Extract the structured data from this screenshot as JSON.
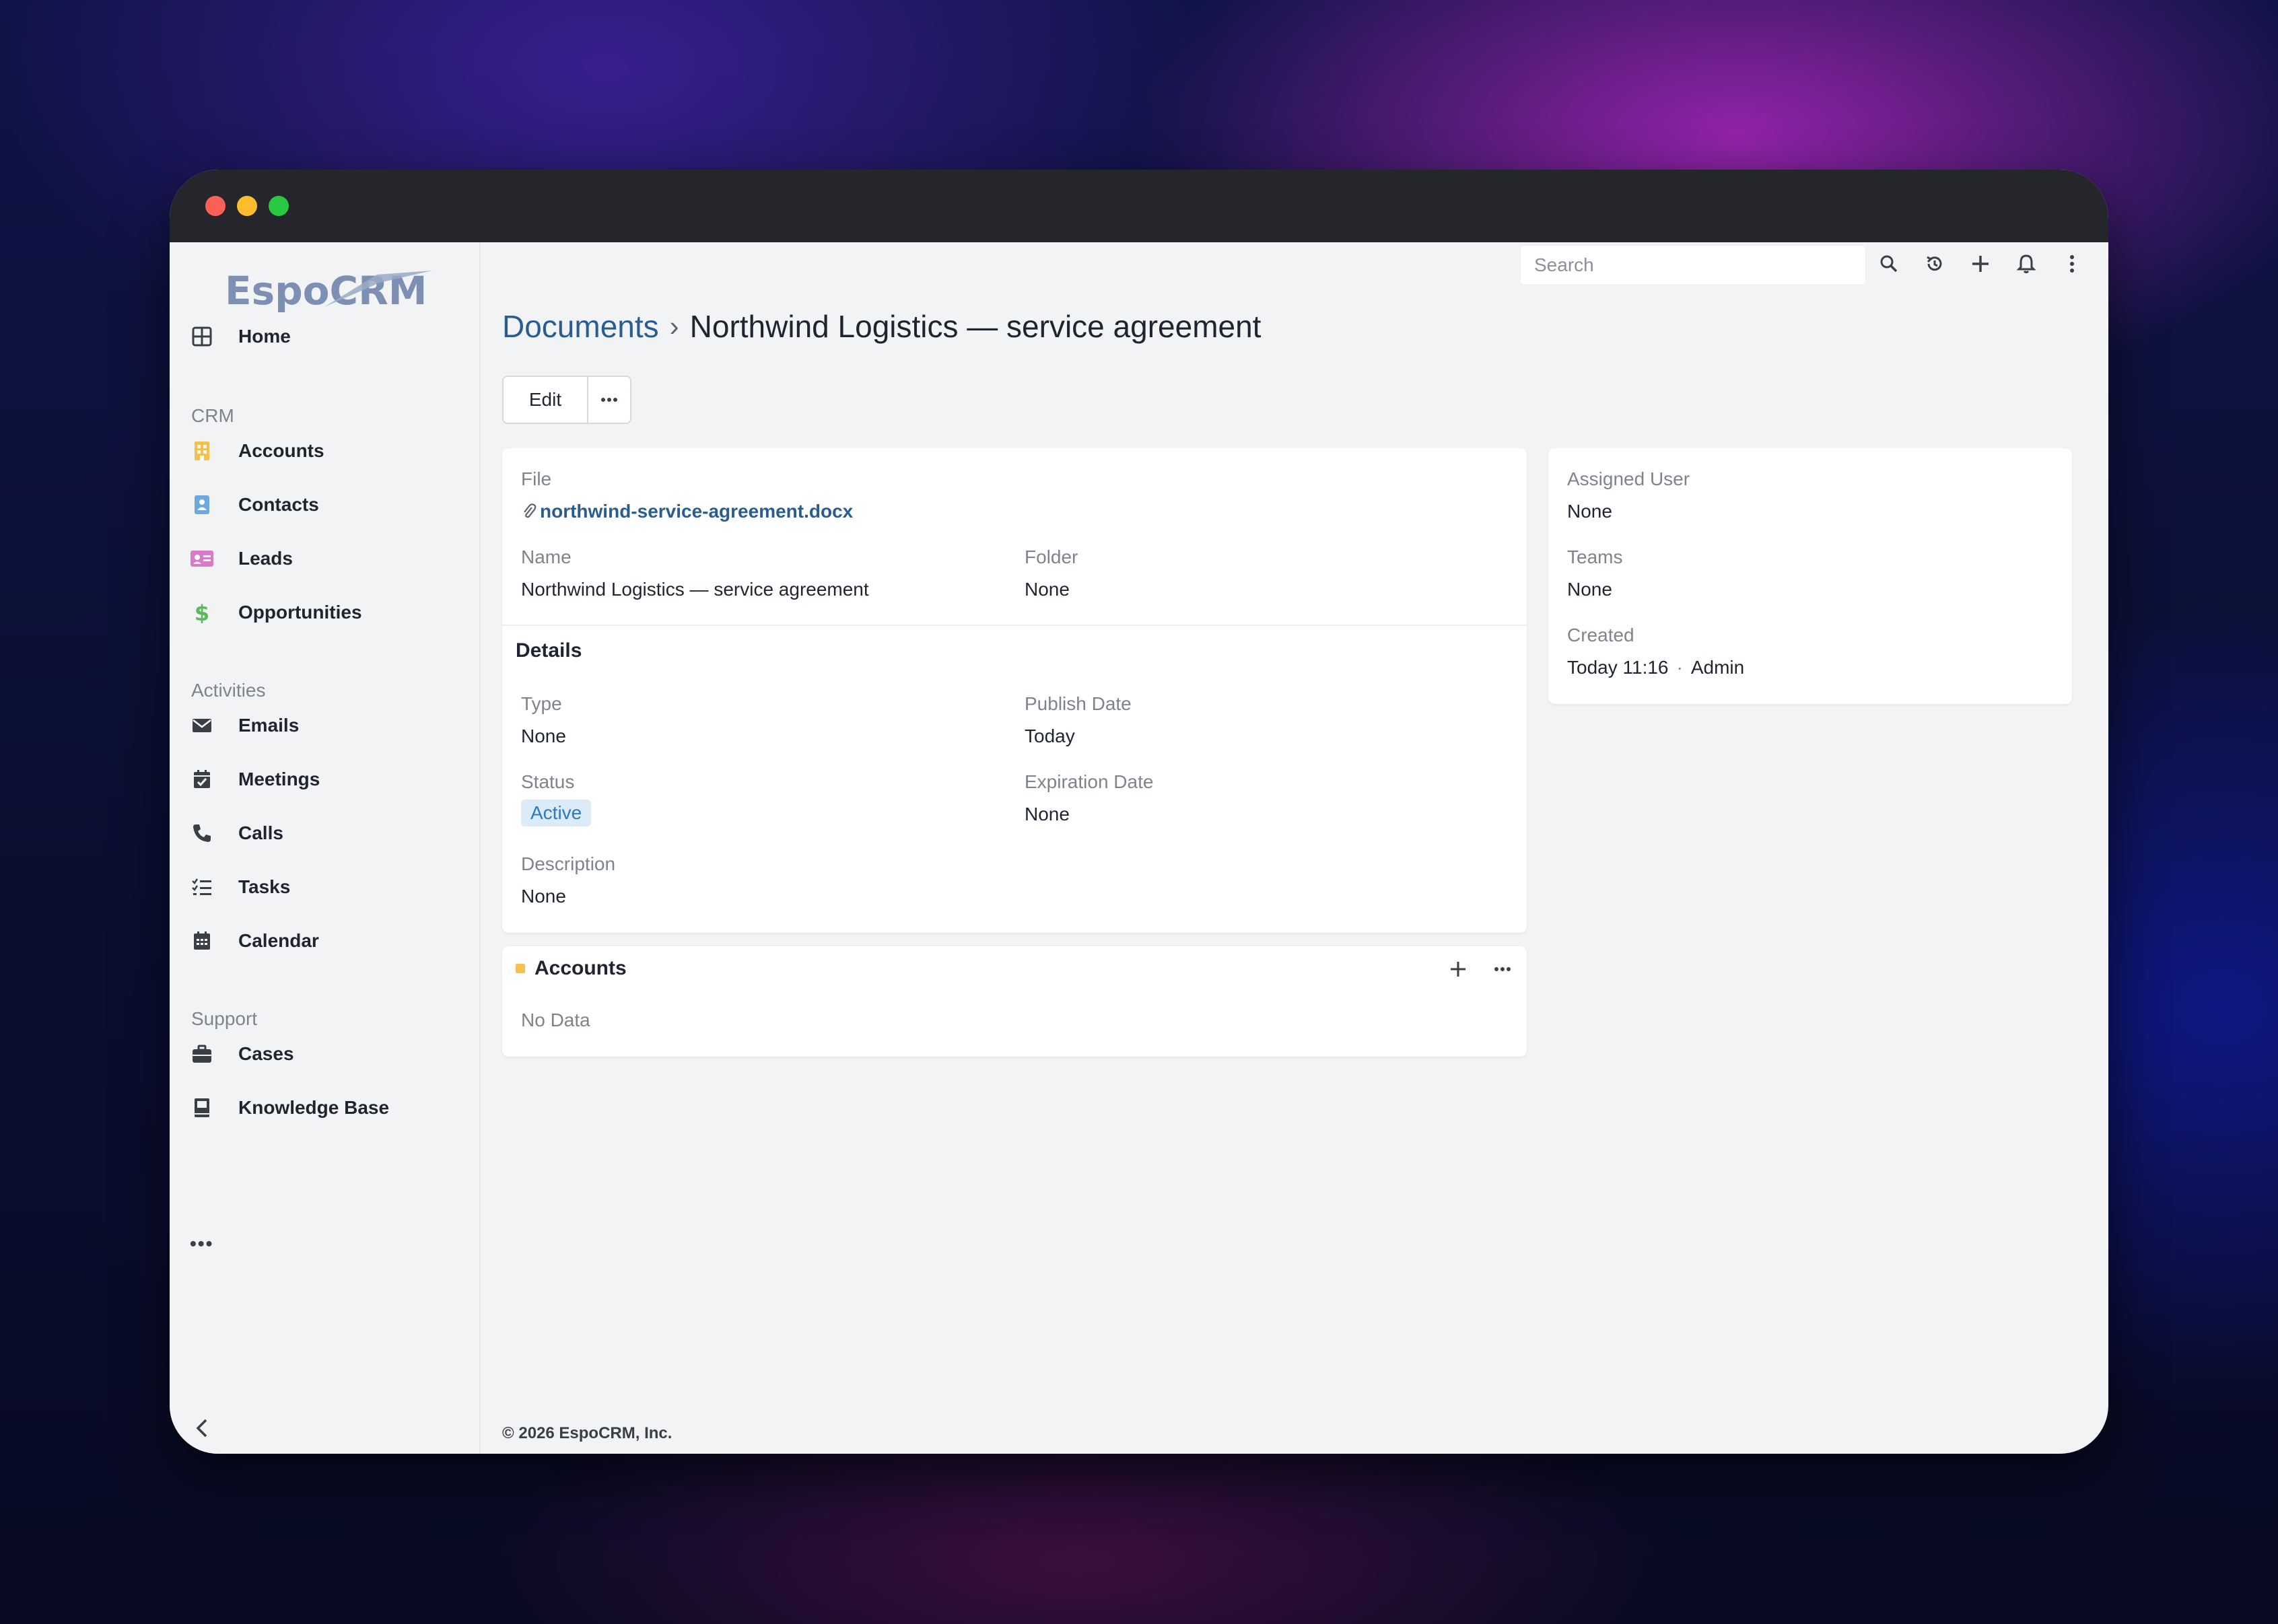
{
  "window": {
    "title": ""
  },
  "logo": {
    "text": "EspoCRM"
  },
  "sidebar": {
    "items": [
      {
        "label": "Home",
        "icon": "grid-icon"
      },
      {
        "label": "Accounts",
        "icon": "building-icon",
        "color": "#f2c14e"
      },
      {
        "label": "Contacts",
        "icon": "contact-card-icon",
        "color": "#6ea8dc"
      },
      {
        "label": "Leads",
        "icon": "id-card-icon",
        "color": "#d97cc8"
      },
      {
        "label": "Opportunities",
        "icon": "dollar-icon",
        "color": "#5cb85c"
      },
      {
        "label": "Emails",
        "icon": "envelope-icon"
      },
      {
        "label": "Meetings",
        "icon": "calendar-check-icon"
      },
      {
        "label": "Calls",
        "icon": "phone-icon"
      },
      {
        "label": "Tasks",
        "icon": "tasks-icon"
      },
      {
        "label": "Calendar",
        "icon": "calendar-icon"
      },
      {
        "label": "Cases",
        "icon": "briefcase-icon"
      },
      {
        "label": "Knowledge Base",
        "icon": "book-icon"
      }
    ],
    "sections": {
      "crm": "CRM",
      "activities": "Activities",
      "support": "Support"
    },
    "more": "•••"
  },
  "header": {
    "search_placeholder": "Search"
  },
  "breadcrumb": {
    "parent": "Documents",
    "separator": "›",
    "title": "Northwind Logistics — service agreement"
  },
  "actions": {
    "edit": "Edit",
    "more": "•••"
  },
  "main_panel": {
    "file_label": "File",
    "file_value": "northwind-service-agreement.docx",
    "name_label": "Name",
    "name_value": "Northwind Logistics — service agreement",
    "folder_label": "Folder",
    "folder_value": "None",
    "details_head": "Details",
    "type_label": "Type",
    "type_value": "None",
    "publish_label": "Publish Date",
    "publish_value": "Today",
    "status_label": "Status",
    "status_value": "Active",
    "expiration_label": "Expiration Date",
    "expiration_value": "None",
    "description_label": "Description",
    "description_value": "None"
  },
  "side_panel": {
    "assigned_label": "Assigned User",
    "assigned_value": "None",
    "teams_label": "Teams",
    "teams_value": "None",
    "created_label": "Created",
    "created_value": "Today 11:16",
    "created_sep": "·",
    "created_by": "Admin"
  },
  "accounts_panel": {
    "title": "Accounts",
    "empty": "No Data",
    "accent": "#f2c14e",
    "more": "•••"
  },
  "footer": {
    "text": "© 2026 EspoCRM, Inc."
  }
}
